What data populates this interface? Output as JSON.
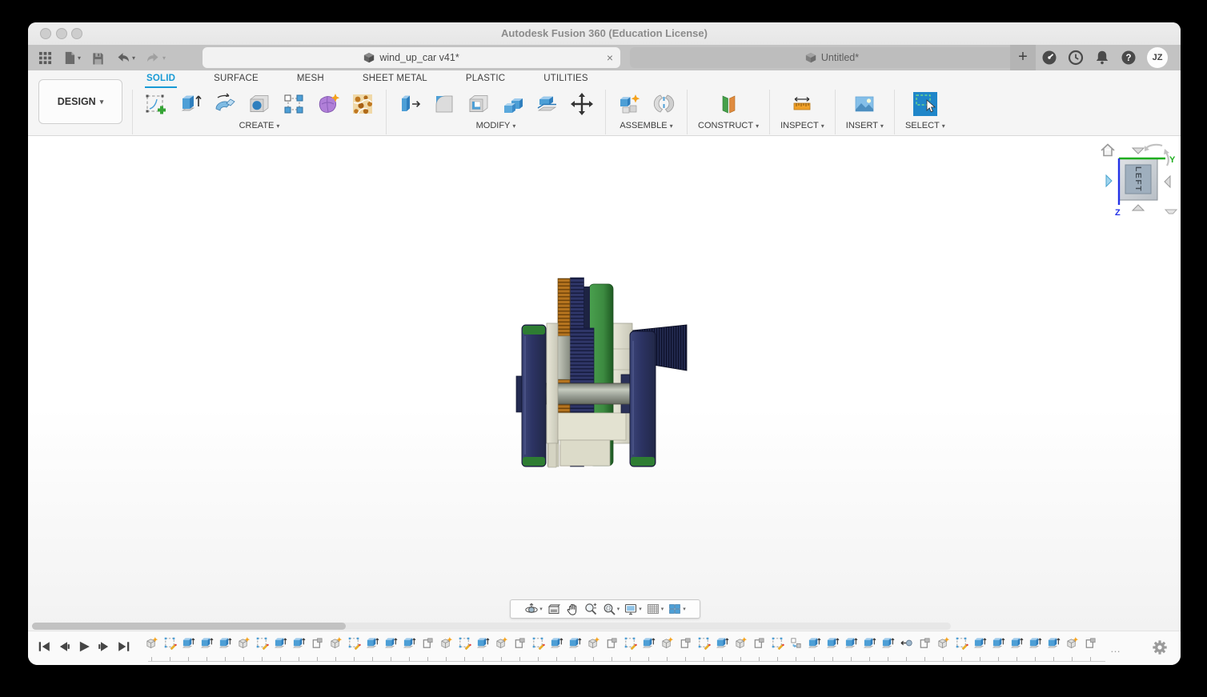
{
  "window": {
    "title": "Autodesk Fusion 360 (Education License)"
  },
  "tabstrip": {
    "documents": [
      {
        "label": "wind_up_car v41*",
        "active": true,
        "close_glyph": "×"
      },
      {
        "label": "Untitled*",
        "active": false,
        "close_glyph": "×"
      }
    ],
    "new_tab_glyph": "+",
    "help_glyph": "?",
    "avatar_initials": "JZ"
  },
  "ribbon": {
    "workspace_label": "DESIGN",
    "tabs": [
      {
        "label": "SOLID",
        "active": true
      },
      {
        "label": "SURFACE",
        "active": false
      },
      {
        "label": "MESH",
        "active": false
      },
      {
        "label": "SHEET METAL",
        "active": false
      },
      {
        "label": "PLASTIC",
        "active": false
      },
      {
        "label": "UTILITIES",
        "active": false
      }
    ],
    "groups": [
      {
        "label": "CREATE",
        "tools": [
          "create-sketch",
          "extrude",
          "revolve",
          "hole",
          "rectangular-pattern",
          "create-form",
          "volumetric-lattice"
        ]
      },
      {
        "label": "MODIFY",
        "tools": [
          "press-pull",
          "fillet",
          "shell",
          "combine",
          "split-body",
          "move-copy"
        ]
      },
      {
        "label": "ASSEMBLE",
        "tools": [
          "new-component",
          "joint"
        ]
      },
      {
        "label": "CONSTRUCT",
        "tools": [
          "construction-plane"
        ]
      },
      {
        "label": "INSPECT",
        "tools": [
          "measure"
        ]
      },
      {
        "label": "INSERT",
        "tools": [
          "insert-image"
        ]
      },
      {
        "label": "SELECT",
        "tools": [
          "select-window"
        ]
      }
    ],
    "accent_blue": "#189ad5"
  },
  "viewport": {
    "model_name": "wind_up_car",
    "viewcube": {
      "visible_face": "LEFT",
      "axis_labels": {
        "y": "Y",
        "z": "Z"
      },
      "axis_colors": {
        "y": "#1fae1f",
        "z": "#2433e8"
      }
    },
    "model_colors": {
      "wheel_navy": "#2c3363",
      "tread_green": "#2e7d33",
      "disc_green": "#3f8f43",
      "gear_orange": "#b5741f",
      "gear_navy": "#2c3261",
      "chassis_beige": "#dddccb",
      "axle_gray": "#9aa096",
      "spring_cone_navy": "#232a50"
    }
  },
  "navbar": {
    "tools": [
      "orbit",
      "look-at",
      "pan",
      "zoom",
      "fit",
      "display-settings",
      "grid-display",
      "viewports"
    ]
  },
  "timeline": {
    "items": [
      "component",
      "sketch",
      "extrude",
      "extrude",
      "extrude",
      "component",
      "sketch",
      "extrude",
      "extrude",
      "plane",
      "component",
      "sketch",
      "extrude",
      "extrude",
      "extrude",
      "plane",
      "component",
      "sketch",
      "extrude",
      "component",
      "plane",
      "sketch",
      "extrude",
      "extrude",
      "component",
      "plane",
      "sketch",
      "extrude",
      "component",
      "plane",
      "sketch",
      "extrude",
      "component",
      "plane",
      "sketch",
      "paste",
      "extrude",
      "extrude",
      "extrude",
      "extrude",
      "extrude",
      "joint",
      "plane",
      "component",
      "sketch",
      "extrude",
      "extrude",
      "extrude",
      "extrude",
      "extrude",
      "component",
      "plane"
    ],
    "overflow_glyph": "…"
  }
}
